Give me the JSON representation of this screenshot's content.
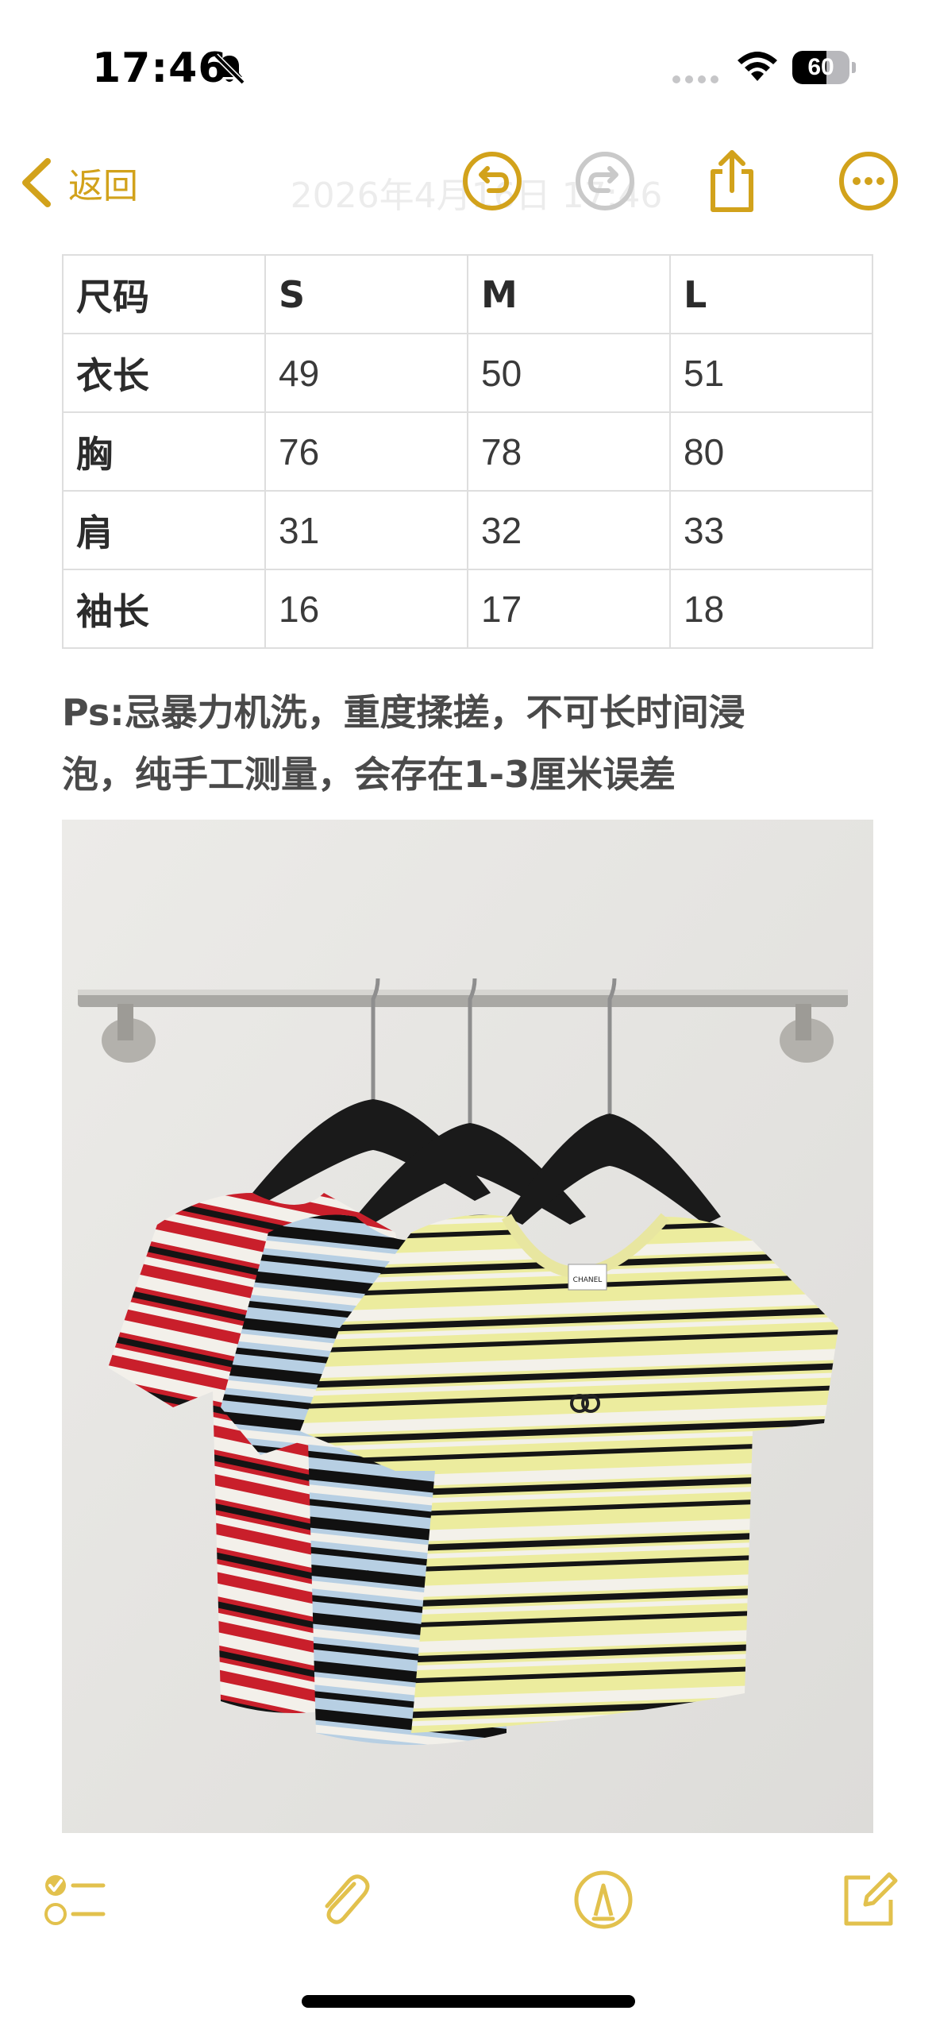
{
  "status_bar": {
    "time": "17:46",
    "battery": "60",
    "battery_level": 0.6
  },
  "nav": {
    "back_label": "返回",
    "title": "2026年4月16日 17:46"
  },
  "table": {
    "rows": [
      [
        "尺码",
        "S",
        "M",
        "L"
      ],
      [
        "衣长",
        "49",
        "50",
        "51"
      ],
      [
        "胸",
        "76",
        "78",
        "80"
      ],
      [
        "肩",
        "31",
        "32",
        "33"
      ],
      [
        "袖长",
        "16",
        "17",
        "18"
      ]
    ]
  },
  "note": {
    "line1": "Ps:忌暴力机洗，重度揉搓，不可长时间浸",
    "line2": "泡，纯手工测量，会存在1-3厘米误差"
  },
  "photo": {
    "tag_text": "CHANEL"
  },
  "icons": {
    "bell": "bell-slash-icon",
    "wifi": "wifi-icon",
    "back": "chevron-left-icon",
    "undo": "undo-icon",
    "redo": "redo-icon",
    "share": "share-icon",
    "more": "more-icon",
    "checklist": "checklist-icon",
    "attach": "paperclip-icon",
    "markup": "markup-pen-icon",
    "compose": "compose-icon"
  },
  "colors": {
    "accent": "#d2a21b",
    "accent_light": "#e2c14d"
  }
}
